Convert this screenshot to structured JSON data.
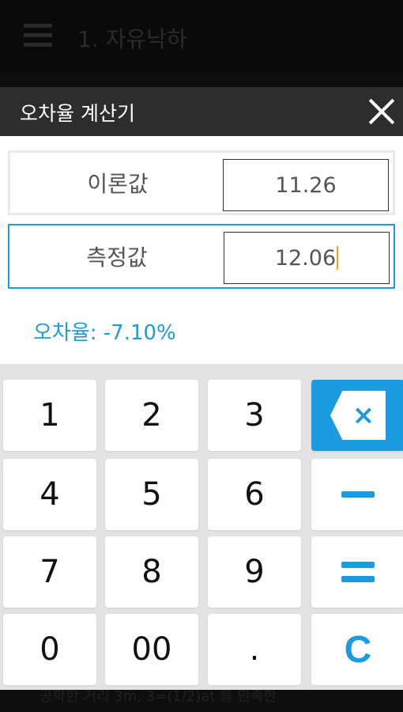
{
  "app": {
    "title": "1. 자유낙하",
    "bottom_text": "공학한 거리 3m, 3=(1/2)at 를 만족한"
  },
  "dialog": {
    "title": "오차율 계산기",
    "theory": {
      "label": "이론값",
      "value": "11.26"
    },
    "measured": {
      "label": "측정값",
      "value": "12.06"
    },
    "result": "오차율: -7.10%"
  },
  "keypad": {
    "k1": "1",
    "k2": "2",
    "k3": "3",
    "k4": "4",
    "k5": "5",
    "k6": "6",
    "k7": "7",
    "k8": "8",
    "k9": "9",
    "k0": "0",
    "k00": "00",
    "kdot": ".",
    "backspace_glyph": "×",
    "clear": "C"
  },
  "colors": {
    "accent": "#1c9be0",
    "header": "#2d2d2d",
    "caret": "#f0a020"
  }
}
